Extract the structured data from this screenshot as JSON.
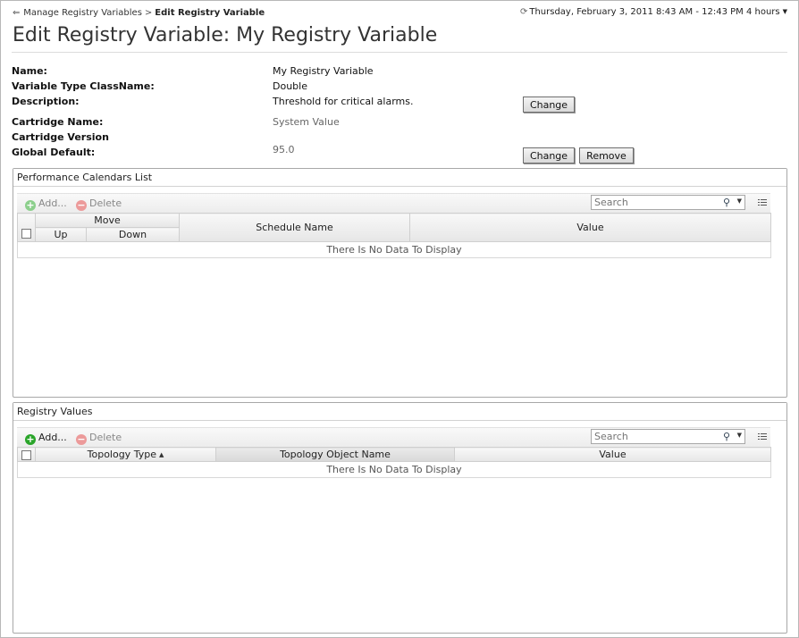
{
  "breadcrumb": {
    "parent": "Manage Registry Variables",
    "separator": ">",
    "current": "Edit Registry Variable"
  },
  "time_range": {
    "text": "Thursday, February 3, 2011 8:43 AM - 12:43 PM 4 hours"
  },
  "page_title": "Edit Registry Variable: My Registry Variable",
  "properties": {
    "name_label": "Name:",
    "name_value": "My Registry Variable",
    "type_label": "Variable Type ClassName:",
    "type_value": "Double",
    "description_label": "Description:",
    "description_value": "Threshold for critical alarms.",
    "cartridge_name_label": "Cartridge Name:",
    "cartridge_name_value": "System Value",
    "cartridge_version_label": "Cartridge Version",
    "global_default_label": "Global Default:",
    "global_default_value": "95.0"
  },
  "buttons": {
    "change": "Change",
    "remove": "Remove"
  },
  "calendars_panel": {
    "title": "Performance Calendars List",
    "add": "Add...",
    "delete": "Delete",
    "search_placeholder": "Search",
    "columns": {
      "move": "Move",
      "up": "Up",
      "down": "Down",
      "schedule_name": "Schedule Name",
      "value": "Value"
    },
    "empty_text": "There Is No Data To Display"
  },
  "registry_panel": {
    "title": "Registry Values",
    "add": "Add...",
    "delete": "Delete",
    "search_placeholder": "Search",
    "columns": {
      "topology_type": "Topology Type",
      "topology_object_name": "Topology Object Name",
      "value": "Value"
    },
    "sort_column": "Topology Type",
    "sort_direction": "ascending",
    "empty_text": "There Is No Data To Display"
  }
}
